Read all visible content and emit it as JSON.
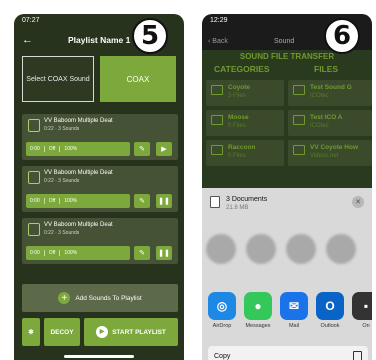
{
  "phone1": {
    "time": "07:27",
    "step": "5",
    "title": "Playlist Name 1",
    "seg_left": "Select COAX Sound",
    "seg_right": "COAX",
    "cards": [
      {
        "title": "VV Baboom Multiple Deat",
        "sub": "0:22 · 3 Sounds",
        "time": "0:00",
        "mode": "Off",
        "vol": "100%",
        "action": "play"
      },
      {
        "title": "VV Baboom Multiple Deat",
        "sub": "0:22 · 3 Sounds",
        "time": "0:00",
        "mode": "Off",
        "vol": "100%",
        "action": "pause"
      },
      {
        "title": "VV Baboom Multiple Deat",
        "sub": "0:22 · 3 Sounds",
        "time": "0:00",
        "mode": "Off",
        "vol": "100%",
        "action": "pause"
      }
    ],
    "add_label": "Add Sounds To Playlist",
    "decoy": "DECOY",
    "start": "START PLAYLIST"
  },
  "phone2": {
    "time": "12:29",
    "step": "6",
    "back": "Back",
    "title": "Sound",
    "overlay_title": "SOUND FILE TRANSFER",
    "categories": "CATEGORIES",
    "files": "FILES",
    "cat_items": [
      {
        "name": "Coyote",
        "sub": "3 Files"
      },
      {
        "name": "Moose",
        "sub": "0 Files"
      },
      {
        "name": "Raccoon",
        "sub": "0 Files"
      }
    ],
    "file_items": [
      {
        "name": "Test Sound G",
        "sub": "ICOtec"
      },
      {
        "name": "Test ICO A",
        "sub": "ICOtec"
      },
      {
        "name": "VV Coyote How",
        "sub": "Videos.net"
      }
    ],
    "doc_title": "3 Documents",
    "doc_size": "21.8 MB",
    "apps": [
      {
        "label": "AirDrop",
        "color": "#1e88e5"
      },
      {
        "label": "Messages",
        "color": "#34c759"
      },
      {
        "label": "Mail",
        "color": "#1a73e8"
      },
      {
        "label": "Outlook",
        "color": "#0a64c8"
      },
      {
        "label": "On",
        "color": "#333333"
      }
    ],
    "copy": "Copy"
  }
}
